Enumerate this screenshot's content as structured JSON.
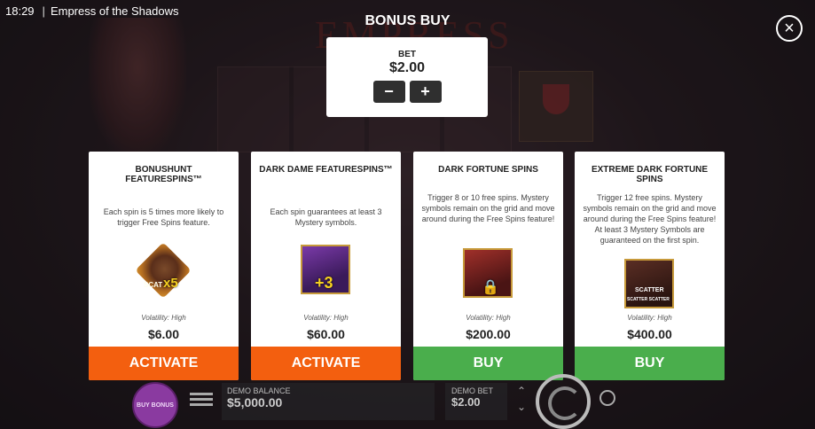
{
  "topbar": {
    "time": "18:29",
    "separator": "|",
    "title": "Empress of the Shadows"
  },
  "background": {
    "logo_text": "EMPRESS"
  },
  "bonus": {
    "title": "BONUS BUY",
    "close_icon": "close-icon"
  },
  "bet": {
    "label": "BET",
    "value": "$2.00",
    "minus": "−",
    "plus": "+"
  },
  "cards": [
    {
      "title": "BONUSHUNT FEATURESPINS™",
      "desc": "Each spin is 5 times more likely to trigger Free Spins feature.",
      "badge": "x5",
      "icon_text": "SCAT",
      "volatility": "Volatility: High",
      "price": "$6.00",
      "button": "ACTIVATE"
    },
    {
      "title": "DARK DAME FEATURESPINS™",
      "desc": "Each spin guarantees at least 3 Mystery symbols.",
      "badge": "+3",
      "volatility": "Volatility: High",
      "price": "$60.00",
      "button": "ACTIVATE"
    },
    {
      "title": "DARK FORTUNE SPINS",
      "desc": "Trigger 8 or 10 free spins. Mystery symbols remain on the grid and move around during the Free Spins feature!",
      "volatility": "Volatility: High",
      "price": "$200.00",
      "button": "BUY"
    },
    {
      "title": "EXTREME DARK FORTUNE SPINS",
      "desc": "Trigger 12 free spins. Mystery symbols remain on the grid and move around during the Free Spins feature! At least 3 Mystery Symbols are guaranteed on the first spin.",
      "icon_text": "SCATTER",
      "icon_text2": "SCATTER SCATTER",
      "volatility": "Volatility: High",
      "price": "$400.00",
      "button": "BUY"
    }
  ],
  "bottom": {
    "buy_bonus": "BUY BONUS",
    "demo_balance_label": "DEMO BALANCE",
    "demo_balance_value": "$5,000.00",
    "demo_bet_label": "DEMO BET",
    "demo_bet_value": "$2.00"
  },
  "colors": {
    "activate": "#f35f0f",
    "buy": "#4aae4c",
    "panel": "#ffffff"
  }
}
